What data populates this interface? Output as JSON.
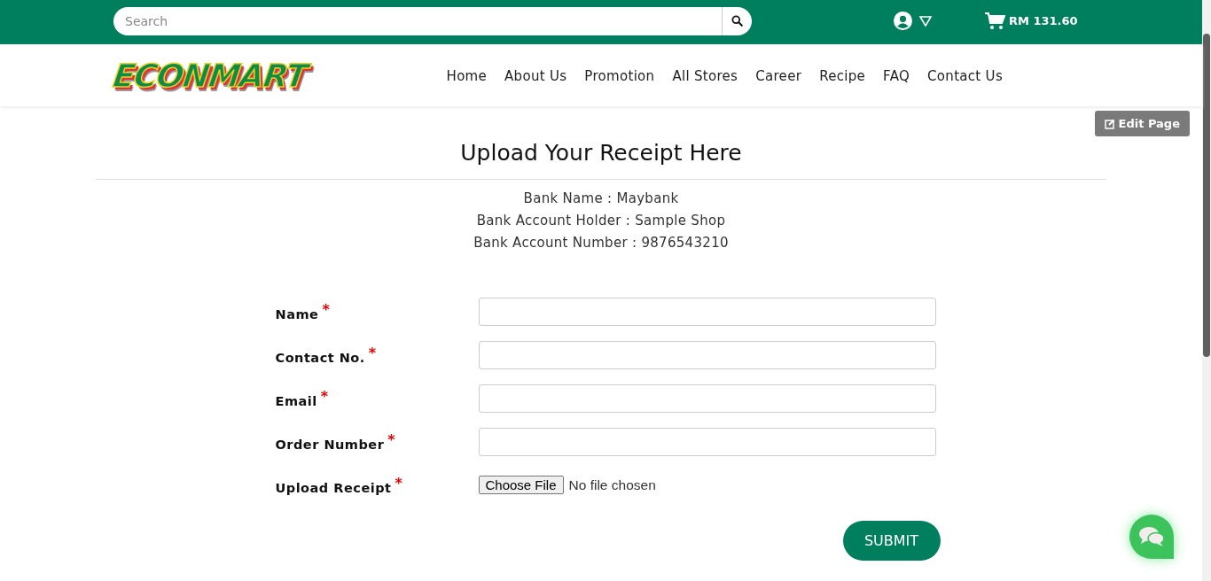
{
  "topbar": {
    "search": {
      "placeholder": "Search"
    },
    "cart_total": "RM 131.60"
  },
  "logo": "ECONMART",
  "nav": [
    {
      "label": "Home"
    },
    {
      "label": "About Us"
    },
    {
      "label": "Promotion"
    },
    {
      "label": "All Stores"
    },
    {
      "label": "Career"
    },
    {
      "label": "Recipe"
    },
    {
      "label": "FAQ"
    },
    {
      "label": "Contact Us"
    }
  ],
  "edit_button": "Edit Page",
  "title": "Upload Your Receipt Here",
  "bank_info": [
    "Bank Name : Maybank",
    "Bank Account Holder : Sample Shop",
    "Bank Account Number : 9876543210"
  ],
  "fields": [
    {
      "label": "Name",
      "required_mark": "*",
      "kind": "text"
    },
    {
      "label": "Contact No.",
      "required_mark": "*",
      "kind": "text"
    },
    {
      "label": "Email",
      "required_mark": "*",
      "kind": "text"
    },
    {
      "label": "Order Number",
      "required_mark": "*",
      "kind": "text"
    },
    {
      "label": "Upload Receipt",
      "required_mark": "*",
      "kind": "file",
      "button": "Choose File",
      "status": "No file chosen"
    }
  ],
  "submit": "SUBMIT"
}
